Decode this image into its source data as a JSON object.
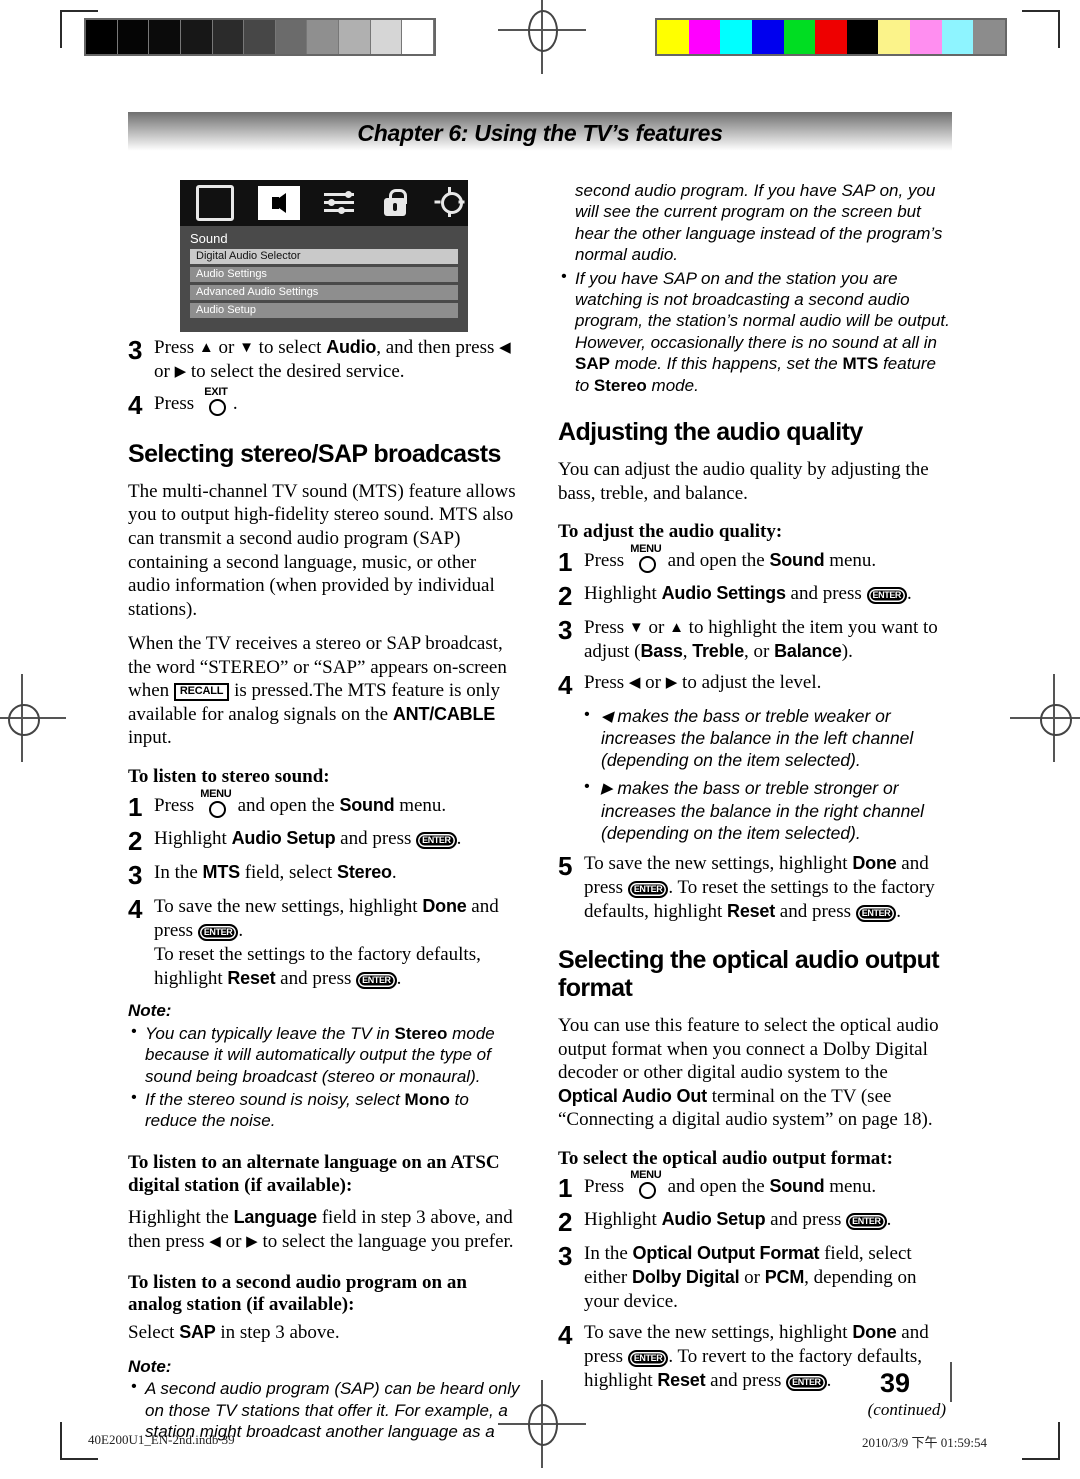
{
  "printer_marks": {
    "grayscale_steps": [
      "#000000",
      "#050505",
      "#0b0b0b",
      "#171717",
      "#2b2b2b",
      "#474747",
      "#6b6b6b",
      "#8f8f8f",
      "#b0b0b0",
      "#d6d6d6",
      "#ffffff"
    ],
    "color_steps": [
      "#ffff00",
      "#ff00ff",
      "#00ffff",
      "#0000ee",
      "#00dd22",
      "#ee0000",
      "#000000",
      "#fbf38a",
      "#ff8ef0",
      "#8ef4ff",
      "#8c8c8c"
    ]
  },
  "chapter": {
    "title": "Chapter 6: Using the TV’s features"
  },
  "tv_menu": {
    "icons": [
      "picture-icon",
      "sound-icon",
      "sliders-icon",
      "lock-icon",
      "gear-icon"
    ],
    "title": "Sound",
    "items": [
      {
        "label": "Digital Audio Selector",
        "highlighted": true
      },
      {
        "label": "Audio Settings",
        "highlighted": false
      },
      {
        "label": "Advanced Audio Settings",
        "highlighted": false
      },
      {
        "label": "Audio Setup",
        "highlighted": false
      }
    ]
  },
  "left_column": {
    "step3": {
      "num": "3",
      "t1": "Press ",
      "ui1": "Audio",
      "t2": "▲ or ▼ to select ",
      "t3": ", and then press ◀ or ▶ to select the desired service."
    },
    "step4": {
      "num": "4",
      "press": "Press",
      "button": "EXIT",
      "period": "."
    },
    "heading1": "Selecting stereo/SAP broadcasts",
    "para1": "The multi-channel TV sound (MTS) feature allows you to output high-fidelity stereo sound. MTS also can transmit a second audio program (SAP) containing a second language, music, or other audio information (when provided by individual stations).",
    "para2_a": "When the TV receives a stereo or SAP broadcast, the word “STEREO” or “SAP” appears on-screen when ",
    "para2_recall": "RECALL",
    "para2_b": " is pressed.The MTS feature is only available for analog signals on the ",
    "para2_ui": "ANT/CABLE",
    "para2_c": " input.",
    "sub1": "To listen to stereo sound:",
    "s1_num": "1",
    "s1_a": "Press ",
    "s1_btn": "MENU",
    "s1_b": " and open the ",
    "s1_ui": "Sound",
    "s1_c": " menu.",
    "s2_num": "2",
    "s2_a": "Highlight ",
    "s2_ui": "Audio Setup",
    "s2_b": " and press ",
    "s2_btn": "ENTER",
    "s2_c": ".",
    "s3_num": "3",
    "s3_a": "In the ",
    "s3_ui1": "MTS",
    "s3_b": " field, select ",
    "s3_ui2": "Stereo",
    "s3_c": ".",
    "s4_num": "4",
    "s4_a": "To save the new settings, highlight ",
    "s4_ui1": "Done",
    "s4_b": " and press ",
    "s4_btn1": "ENTER",
    "s4_c": ".",
    "s4_d": "To reset the settings to the factory defaults, highlight ",
    "s4_ui2": "Reset",
    "s4_e": " and press ",
    "s4_btn2": "ENTER",
    "s4_f": ".",
    "note1_label": "Note:",
    "note1_b1_a": "You can typically leave the TV in ",
    "note1_b1_ui": "Stereo",
    "note1_b1_b": " mode because it will automatically output the type of sound being broadcast (stereo or monaural).",
    "note1_b2_a": "If the stereo sound is noisy, select ",
    "note1_b2_ui": "Mono",
    "note1_b2_b": " to reduce the noise.",
    "sub2": "To listen to an alternate language on an ATSC digital station (if available):",
    "para3_a": "Highlight the ",
    "para3_ui": "Language",
    "para3_b": " field in step 3 above, and then press ◀ or ▶ to select the language you prefer.",
    "sub3": "To listen to a second audio program on an analog station (if available):",
    "para4_a": "Select ",
    "para4_ui": "SAP",
    "para4_b": " in step 3 above.",
    "note2_label": "Note:",
    "note2_b1": "A second audio program (SAP) can be heard only on those TV stations that offer it. For example, a station might broadcast another language as a"
  },
  "right_column": {
    "cont_text": "second audio program. If you have SAP on, you will see the current program on the screen but hear the other language instead of the program’s normal audio.",
    "note_b2_a": "If you have SAP on and the station you are watching is not broadcasting a second audio program, the station’s normal audio will be output. However, occasionally there is no sound at all in ",
    "note_b2_ui1": "SAP",
    "note_b2_b": " mode. If this happens, set the ",
    "note_b2_ui2": "MTS",
    "note_b2_c": " feature to ",
    "note_b2_ui3": "Stereo",
    "note_b2_d": " mode.",
    "heading1": "Adjusting the audio quality",
    "para1": "You can adjust the audio quality by adjusting the bass, treble, and balance.",
    "sub1": "To adjust the audio quality:",
    "s1_num": "1",
    "s1_a": "Press ",
    "s1_btn": "MENU",
    "s1_b": " and open the ",
    "s1_ui": "Sound",
    "s1_c": " menu.",
    "s2_num": "2",
    "s2_a": "Highlight ",
    "s2_ui": "Audio Settings",
    "s2_b": " and press ",
    "s2_btn": "ENTER",
    "s2_c": ".",
    "s3_num": "3",
    "s3_a": "Press ▼ or ▲ to highlight the item you want to adjust (",
    "s3_ui1": "Bass",
    "s3_b": ", ",
    "s3_ui2": "Treble",
    "s3_c": ", or ",
    "s3_ui3": "Balance",
    "s3_d": ").",
    "s4_num": "4",
    "s4_a": "Press ◀ or ▶ to adjust the level.",
    "s4_b1": "◀ makes the bass or treble weaker or increases the balance in the left channel (depending on the item selected).",
    "s4_b2": "▶ makes the bass or treble stronger or increases the balance in the right channel (depending on the item selected).",
    "s5_num": "5",
    "s5_a": "To save the new settings, highlight ",
    "s5_ui1": "Done",
    "s5_b": " and press ",
    "s5_btn1": "ENTER",
    "s5_c": ". To reset the settings to the factory defaults, highlight ",
    "s5_ui2": "Reset",
    "s5_d": " and press ",
    "s5_btn2": "ENTER",
    "s5_e": ".",
    "heading2": "Selecting the optical audio output format",
    "para2_a": "You can use this feature to select the optical audio output format when you connect a Dolby Digital decoder or other digital audio system to the ",
    "para2_ui": "Optical Audio Out",
    "para2_b": " terminal on the TV (see “Connecting a digital audio system” on page 18).",
    "sub2": "To select the optical audio output format:",
    "t1_num": "1",
    "t1_a": "Press ",
    "t1_btn": "MENU",
    "t1_b": " and open the ",
    "t1_ui": "Sound",
    "t1_c": " menu.",
    "t2_num": "2",
    "t2_a": "Highlight ",
    "t2_ui": "Audio Setup",
    "t2_b": " and press ",
    "t2_btn": "ENTER",
    "t2_c": ".",
    "t3_num": "3",
    "t3_a": "In the ",
    "t3_ui1": "Optical Output Format",
    "t3_b": " field, select either ",
    "t3_ui2": "Dolby Digital",
    "t3_c": " or ",
    "t3_ui3": "PCM",
    "t3_d": ", depending on your device.",
    "t4_num": "4",
    "t4_a": "To save the new settings, highlight ",
    "t4_ui1": "Done",
    "t4_b": " and press ",
    "t4_btn1": "ENTER",
    "t4_c": ". To revert to the factory defaults, highlight ",
    "t4_ui2": "Reset",
    "t4_d": " and press ",
    "t4_btn2": "ENTER",
    "t4_e": ".",
    "continued": "(continued)"
  },
  "footer": {
    "page_number": "39",
    "file_label": "40E200U1_EN-2nd.indb   39",
    "timestamp": "2010/3/9   下午 01:59:54"
  }
}
